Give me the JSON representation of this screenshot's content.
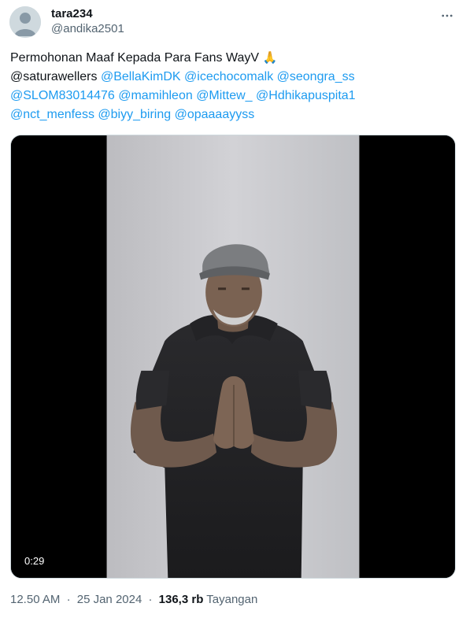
{
  "author": {
    "display_name": "tara234",
    "handle": "@andika2501",
    "avatar_icon": "default-avatar-icon"
  },
  "menu_icon": "more-horizontal-icon",
  "tweet": {
    "line1_text": "Permohonan Maaf Kepada Para Fans WayV",
    "line1_emoji": "🙏",
    "mentions_line1": [
      "@saturawellers"
    ],
    "mentions_line1_colored": [
      "@BellaKimDK",
      "@icechocomalk",
      "@seongra_ss"
    ],
    "mentions_line2": [
      "@SLOM83014476",
      "@mamihleon",
      "@Mittew_",
      "@Hdhikapuspita1"
    ],
    "mentions_line3": [
      "@nct_menfess",
      "@biyy_biring",
      "@opaaaayyss"
    ]
  },
  "video": {
    "duration": "0:29"
  },
  "meta": {
    "time": "12.50 AM",
    "date": "25 Jan 2024",
    "views_count": "136,3 rb",
    "views_label": "Tayangan",
    "separator": "·"
  },
  "colors": {
    "link": "#1d9bf0",
    "secondary_text": "#536471",
    "primary_text": "#0f1419"
  }
}
